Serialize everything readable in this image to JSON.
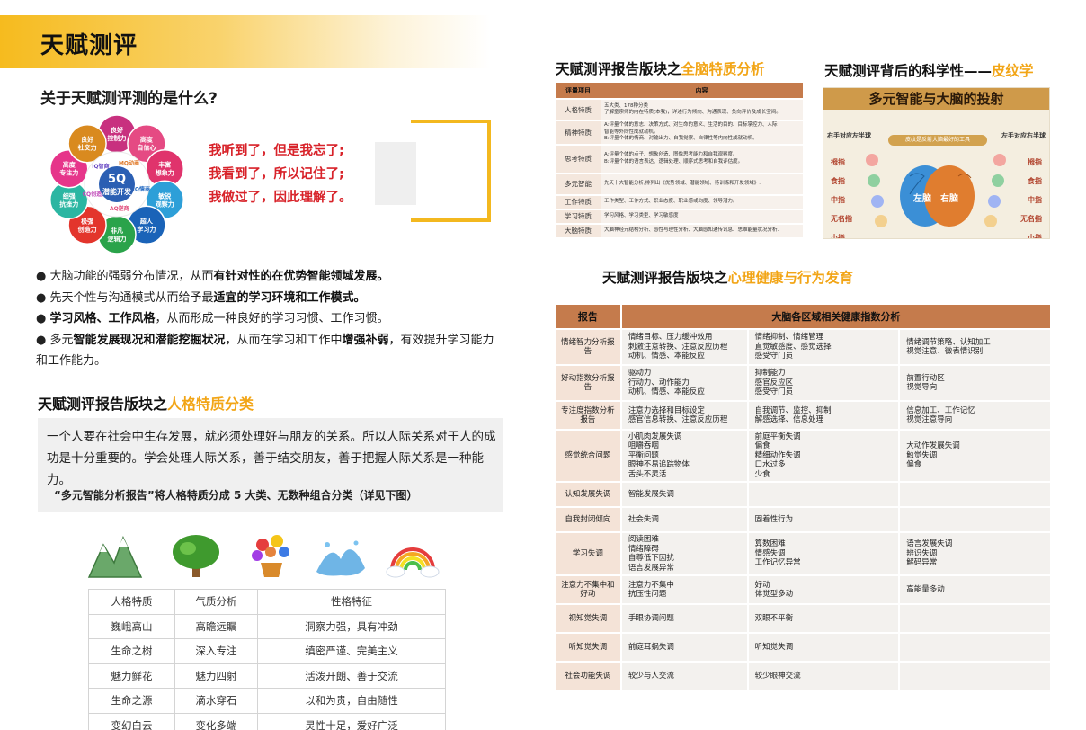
{
  "page_title": "天赋测评",
  "question_title": "关于天赋测评测的是什么?",
  "flower": {
    "center_top": "5Q",
    "center_bottom": "潜能开发",
    "petals": [
      "良好\n控制力",
      "高度\n自信心",
      "丰富\n想象力",
      "敏锐\n观察力",
      "超人\n学习力",
      "非凡\n逻辑力",
      "极强\n创造力",
      "细强\n抗挫力",
      "高度\n专注力",
      "良好\n社交力"
    ],
    "inner": [
      "MQ动商",
      "EQ情商",
      "AQ逆商",
      "CQ创造力",
      "IQ智商"
    ]
  },
  "quotes": [
    "我听到了，但是我忘了;",
    "我看到了，所以记住了;",
    "我做过了，因此理解了。"
  ],
  "bullets": [
    [
      {
        "t": "大脑功能的强弱分布情况，从而",
        "b": false
      },
      {
        "t": "有针对性的在优势智能领域发展。",
        "b": true
      }
    ],
    [
      {
        "t": "先天个性与沟通模式从而给予最",
        "b": false
      },
      {
        "t": "适宜的学习环境和工作模式。",
        "b": true
      }
    ],
    [
      {
        "t": "学习风格、工作风格",
        "b": true
      },
      {
        "t": "，从而形成一种良好的学习习惯、工作习惯。",
        "b": false
      }
    ],
    [
      {
        "t": "多元",
        "b": false
      },
      {
        "t": "智能发展现况和潜能挖掘状况",
        "b": true
      },
      {
        "t": "，从而在学习和工作中",
        "b": false
      },
      {
        "t": "增强补弱",
        "b": true
      },
      {
        "t": "，有效提升学习能力和工作能力。",
        "b": false
      }
    ]
  ],
  "section_personality": {
    "prefix": "天赋测评报告版块之",
    "highlight": "人格特质分类"
  },
  "intro": "一个人要在社会中生存发展，就必须处理好与朋友的关系。所以人际关系对于人的成功是十分重要的。学会处理人际关系，善于结交朋友，善于把握人际关系是一种能力。",
  "intro_note": "“多元智能分析报告”将人格特质分成 5 大类、无数种组合分类（详见下图）",
  "personality_table": {
    "headers": [
      "人格特质",
      "气质分析",
      "性格特征"
    ],
    "rows": [
      [
        "巍峨高山",
        "高瞻远瞩",
        "洞察力强，具有冲劲"
      ],
      [
        "生命之树",
        "深入专注",
        "缜密严谨、完美主义"
      ],
      [
        "魅力鲜花",
        "魅力四射",
        "活泼开朗、善于交流"
      ],
      [
        "生命之源",
        "滴水穿石",
        "以和为贵，自由随性"
      ],
      [
        "变幻白云",
        "变化多端",
        "灵性十足，爱好广泛"
      ]
    ]
  },
  "section_brain": {
    "prefix": "天赋测评报告版块之",
    "highlight": "全脑特质分析"
  },
  "brain_table": {
    "headers": [
      "评量项目",
      "内容"
    ],
    "rows": [
      [
        "人格特质",
        "五大类、178种分类\n了解童宗师的内在特质(本我)，详述行为倾向、沟通表现、负向评价及成长空间。"
      ],
      [
        "精神特质",
        "A:评量个体的意志、决策方式、对生命的意义、生活的目的、目标掌控力、人际\n智能等外向性成就动机。\nB:评量个体的情商、对输出力、自我觉察、自律性等内向性成就动机。"
      ],
      [
        "思考特质",
        "A:评量个体的点子、想象创造、图像思考能力和自我观察度。\nB:评量个体的语言表达、逻辑处理、顺序式思考和自我评估度。"
      ],
      [
        "多元智能",
        "先天十大智能分析,排列出《优势领域、潜能领域、待训练和开发领域》."
      ],
      [
        "工作特质",
        "工作类型、工作方式、职业态度、职业感或向度、领导潜力。"
      ],
      [
        "学习特质",
        "学习风格、学习类型、学习敏感度"
      ],
      [
        "大脑特质",
        "大脑神经元结构分析、感性与理性分析、大脑感知通传讯息、思维能量状况分析."
      ]
    ]
  },
  "section_science": {
    "prefix": "天赋测评背后的科学性——",
    "highlight": "皮纹学"
  },
  "brain_image": {
    "title": "多元智能与大脑的投射",
    "right_hand": "右手对应左半球",
    "left_hand": "左手对应右半球",
    "banner": "皮纹是反射大脑最好的工具",
    "left_brain": "左脑",
    "right_brain": "右脑",
    "fingers": [
      "拇指",
      "食指",
      "中指",
      "无名指",
      "小指"
    ]
  },
  "section_mental": {
    "prefix": "天赋测评报告版块之",
    "highlight": "心理健康与行为发育"
  },
  "mental_table": {
    "headers": [
      "报告",
      "大脑各区域相关健康指数分析"
    ],
    "rows": [
      [
        "情绪智力分析报告",
        "情绪目标、压力缓冲效用\n刺激注意转换、注意反应历程\n动机、情感、本能反应",
        "情绪抑制、情绪管理\n直觉敏感度、感觉选择\n感受守门员",
        "情绪调节策略、认知加工\n视觉注意、微表情识别"
      ],
      [
        "好动指数分析报告",
        "驱动力\n行动力、动作能力\n动机、情感、本能反应",
        "抑制能力\n感官反应区\n感受守门员",
        "前置行动区\n视觉导向"
      ],
      [
        "专注度指数分析报告",
        "注意力选择和目标设定\n感官信息转换、注意反应历程",
        "自我调节、监控、抑制\n解感选择、信息处理",
        "信息加工、工作记忆\n视觉注意导向"
      ],
      [
        "感觉统合问题",
        "小肌肉发展失调\n咀嚼吞咽\n平衡问题\n眼神不易追踪物体\n舌头不灵活",
        "前庭平衡失调\n偏食\n精细动作失调\n口水过多\n少食",
        "大动作发展失调\n触觉失调\n偏食"
      ],
      [
        "认知发展失调",
        "智能发展失调",
        "",
        ""
      ],
      [
        "自我封闭倾向",
        "社会失调",
        "固着性行为",
        ""
      ],
      [
        "学习失调",
        "阅读困难\n情绪障碍\n自尊低下因扰\n语言发展异常",
        "算数困难\n情感失调\n工作记忆异常",
        "语言发展失调\n辨识失调\n解码异常"
      ],
      [
        "注意力不集中和好动",
        "注意力不集中\n抗压性问题",
        "好动\n体觉型多动",
        "高能量多动"
      ],
      [
        "视知觉失调",
        "手眼协调问题",
        "双眼不平衡",
        ""
      ],
      [
        "听知觉失调",
        "前庭耳蜗失调",
        "听知觉失调",
        ""
      ],
      [
        "社会功能失调",
        "较少与人交流",
        "较少眼神交流",
        ""
      ]
    ]
  },
  "colors": {
    "accent": "#f2a516",
    "red": "#d8232a",
    "table_header": "#c57b4c"
  }
}
